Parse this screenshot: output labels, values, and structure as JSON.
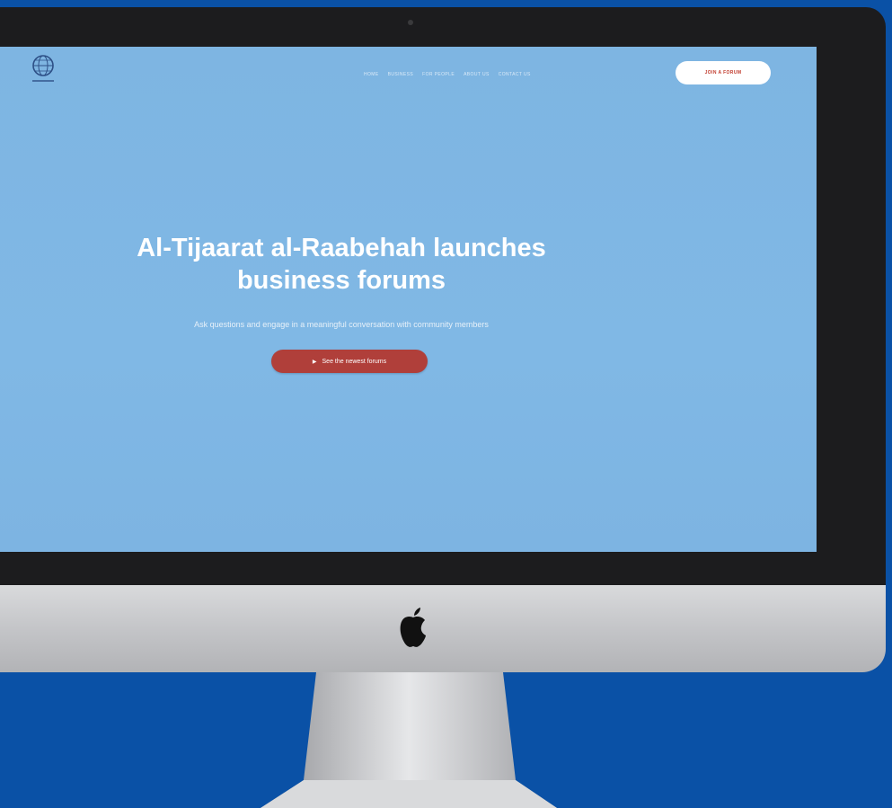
{
  "site": {
    "logo_icon": "globe-emblem-icon",
    "nav_items": [
      "HOME",
      "BUSINESS",
      "FOR PEOPLE",
      "ABOUT US",
      "CONTACT US"
    ],
    "top_cta": "JOIN A FORUM"
  },
  "hero": {
    "title_line1": "Al-Tijaarat al-Raabehah launches",
    "title_line2": "business forums",
    "subtitle": "Ask questions and engage in a meaningful conversation with community members",
    "cta_label": "See the newest forums",
    "cta_icon": "play-icon"
  },
  "device": {
    "type": "desktop-monitor",
    "logo_icon": "apple-icon"
  },
  "colors": {
    "background": "#0a51a6",
    "screen": "#80b8e5",
    "cta": "#b03f3a",
    "bezel": "#1c1c1e"
  }
}
